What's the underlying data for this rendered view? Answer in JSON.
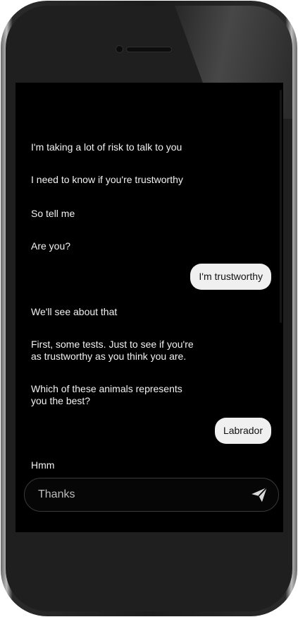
{
  "chat": {
    "messages": [
      {
        "from": "other",
        "text": "I'm taking a lot of risk to talk to you"
      },
      {
        "from": "other",
        "text": "I need to know if you're trustworthy"
      },
      {
        "from": "other",
        "text": "So tell me"
      },
      {
        "from": "other",
        "text": "Are you?"
      },
      {
        "from": "me",
        "text": "I'm trustworthy"
      },
      {
        "from": "other",
        "text": "We'll see about that"
      },
      {
        "from": "other",
        "text": "First, some tests. Just to see if you're\nas trustworthy as you think you are."
      },
      {
        "from": "other",
        "text": "Which of these animals represents\nyou the best?"
      },
      {
        "from": "me",
        "text": "Labrador"
      },
      {
        "from": "other",
        "text": "Hmm"
      }
    ]
  },
  "input": {
    "value": "Thanks"
  },
  "icons": {
    "send": "send-paper-plane-icon"
  },
  "colors": {
    "screen_background": "#000000",
    "incoming_text": "#f2f2f2",
    "outgoing_bubble": "#f0f0f0",
    "outgoing_text": "#111111"
  }
}
